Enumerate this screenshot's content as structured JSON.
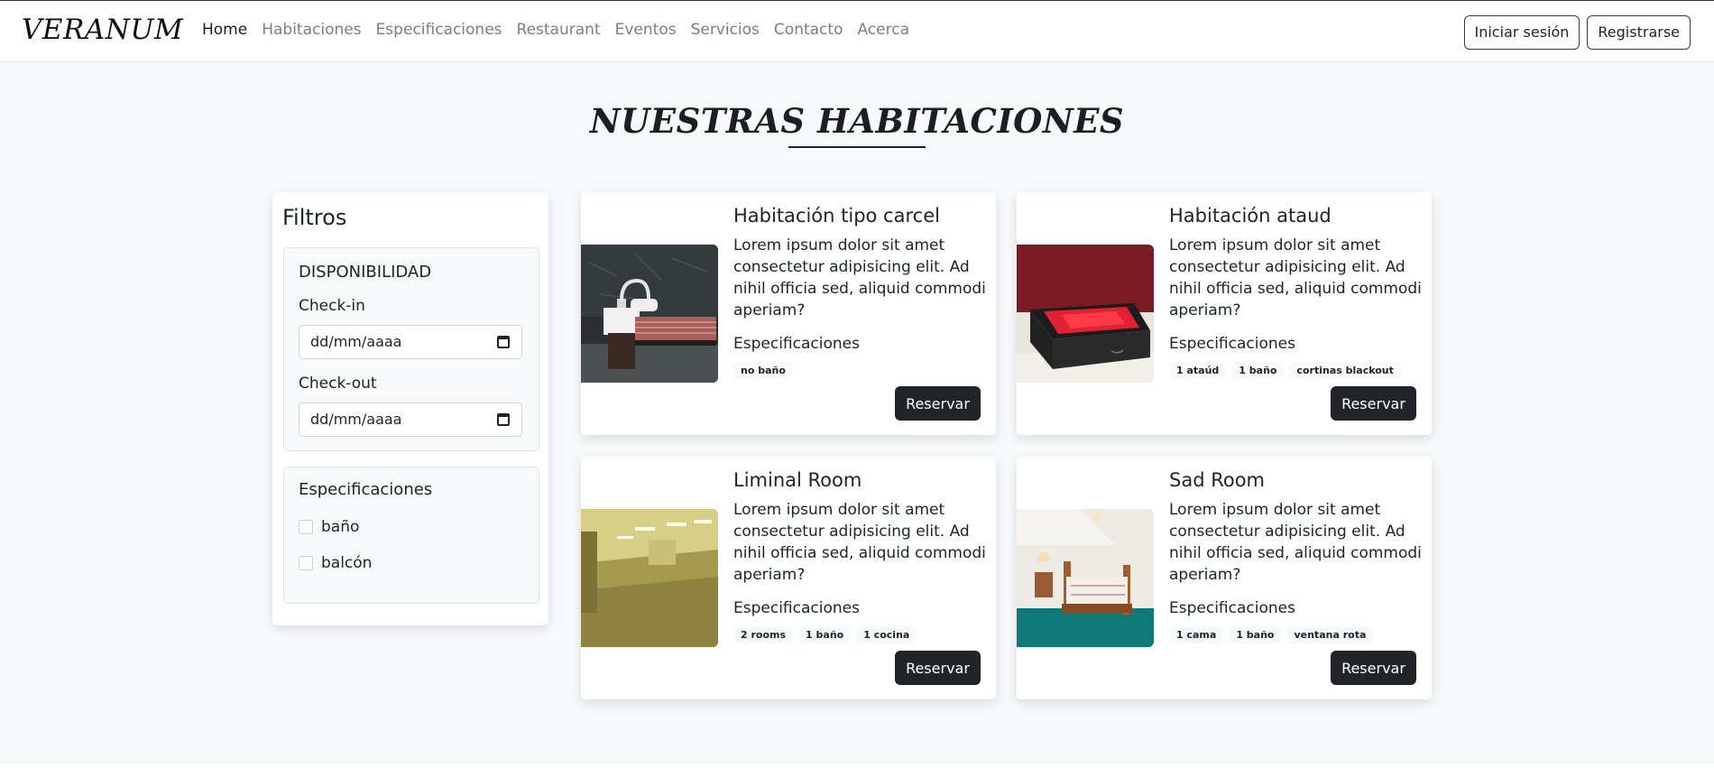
{
  "brand": "VERANUM",
  "nav": {
    "items": [
      {
        "label": "Home",
        "active": true
      },
      {
        "label": "Habitaciones",
        "active": false
      },
      {
        "label": "Especificaciones",
        "active": false
      },
      {
        "label": "Restaurant",
        "active": false
      },
      {
        "label": "Eventos",
        "active": false
      },
      {
        "label": "Servicios",
        "active": false
      },
      {
        "label": "Contacto",
        "active": false
      },
      {
        "label": "Acerca",
        "active": false
      }
    ],
    "login_label": "Iniciar sesión",
    "register_label": "Registrarse"
  },
  "page_title": "NUESTRAS HABITACIONES",
  "filters": {
    "title": "Filtros",
    "availability": {
      "heading": "DISPONIBILIDAD",
      "checkin_label": "Check-in",
      "checkin_placeholder": "dd/mm/aaaa",
      "checkout_label": "Check-out",
      "checkout_placeholder": "dd/mm/aaaa"
    },
    "specs": {
      "heading": "Especificaciones",
      "options": [
        {
          "label": "baño",
          "checked": false
        },
        {
          "label": "balcón",
          "checked": false
        }
      ]
    }
  },
  "rooms": [
    {
      "title": "Habitación tipo carcel",
      "description": "Lorem ipsum dolor sit amet consectetur adipisicing elit. Ad nihil officia sed, aliquid commodi aperiam?",
      "specs_label": "Especificaciones",
      "tags": [
        "no baño"
      ],
      "button": "Reservar"
    },
    {
      "title": "Habitación ataud",
      "description": "Lorem ipsum dolor sit amet consectetur adipisicing elit. Ad nihil officia sed, aliquid commodi aperiam?",
      "specs_label": "Especificaciones",
      "tags": [
        "1 ataúd",
        "1 baño",
        "cortinas blackout"
      ],
      "button": "Reservar"
    },
    {
      "title": "Liminal Room",
      "description": "Lorem ipsum dolor sit amet consectetur adipisicing elit. Ad nihil officia sed, aliquid commodi aperiam?",
      "specs_label": "Especificaciones",
      "tags": [
        "2 rooms",
        "1 baño",
        "1 cocina"
      ],
      "button": "Reservar"
    },
    {
      "title": "Sad Room",
      "description": "Lorem ipsum dolor sit amet consectetur adipisicing elit. Ad nihil officia sed, aliquid commodi aperiam?",
      "specs_label": "Especificaciones",
      "tags": [
        "1 cama",
        "1 baño",
        "ventana rota"
      ],
      "button": "Reservar"
    }
  ],
  "colors": {
    "page_bg": "#f8f9fa",
    "dark": "#212529",
    "nav_muted": "#7a7f85"
  }
}
